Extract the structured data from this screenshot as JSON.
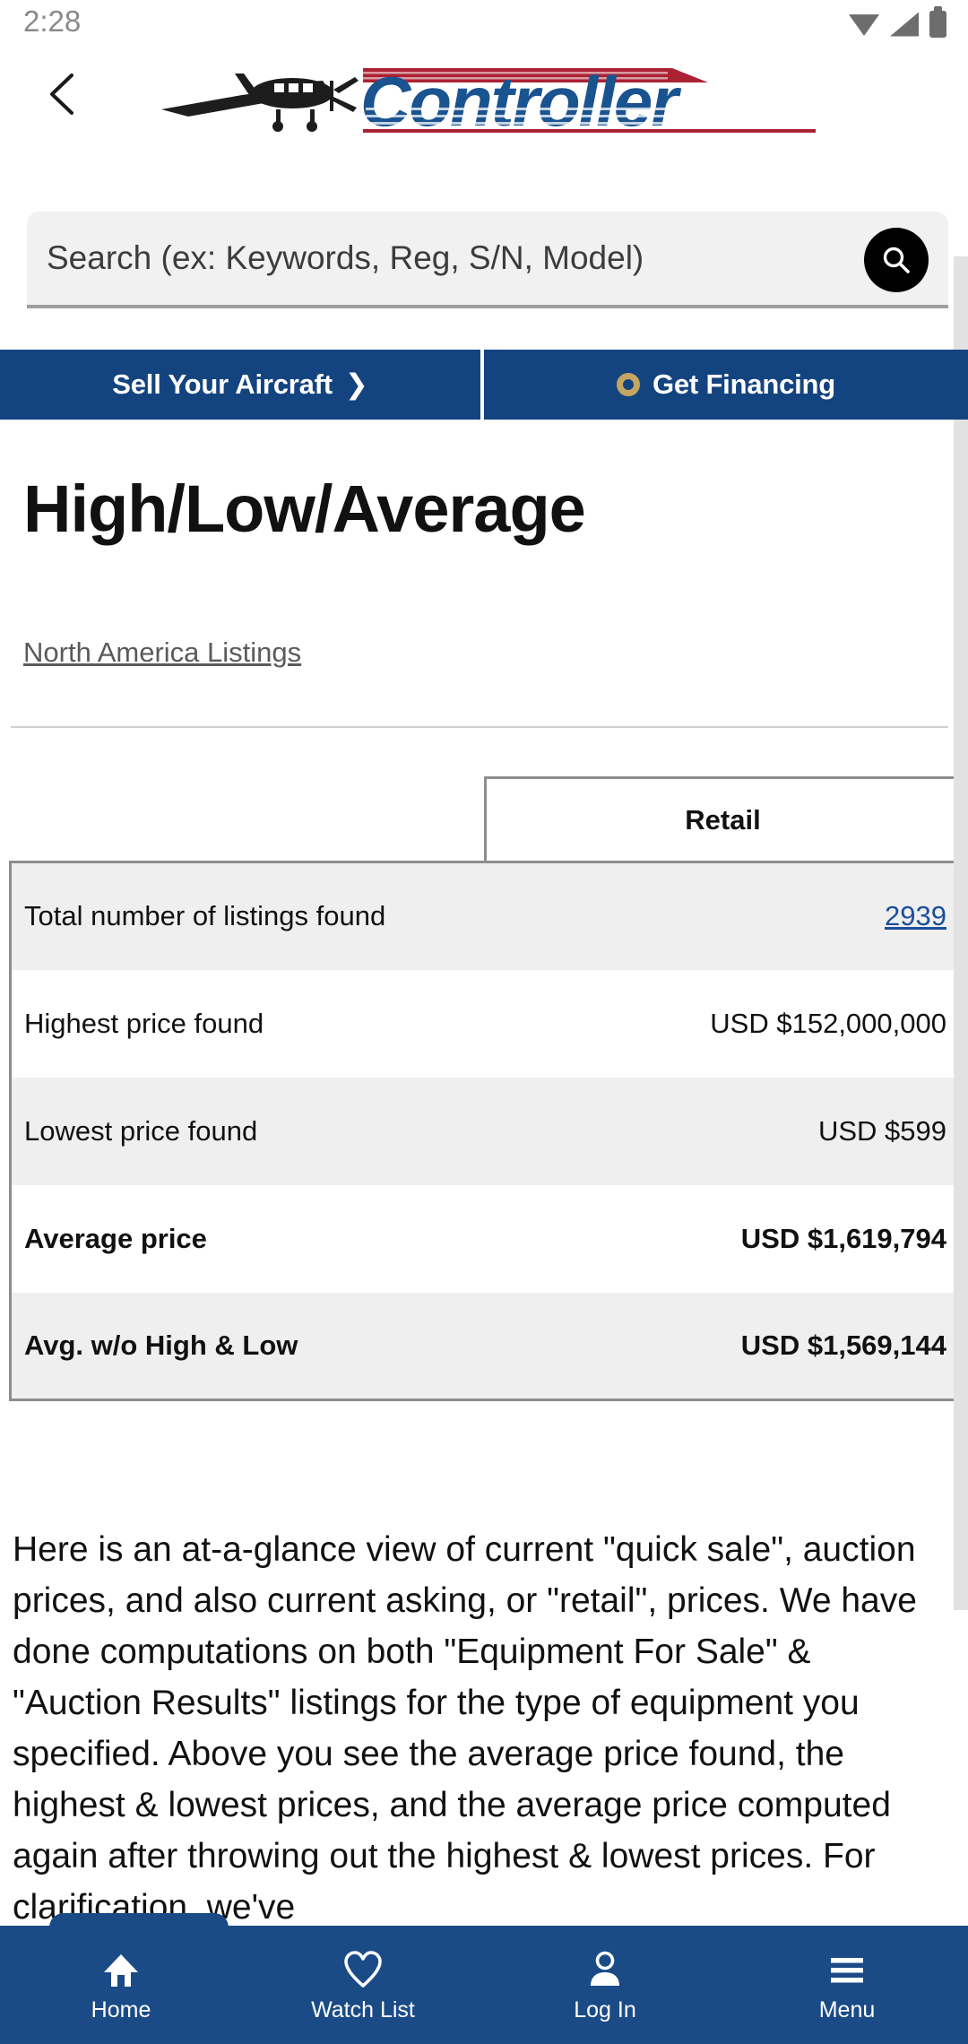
{
  "status_bar": {
    "time": "2:28",
    "icons": [
      "wifi-icon",
      "cell-signal-icon",
      "battery-icon"
    ]
  },
  "header": {
    "back_icon": "chevron-left-icon",
    "logo_text": "Controller",
    "logo_icon": "airplane-icon"
  },
  "search": {
    "placeholder": "Search (ex: Keywords, Reg, S/N, Model)",
    "value": "",
    "button_icon": "search-icon"
  },
  "action_bar": {
    "sell_label": "Sell Your Aircraft",
    "sell_icon": "chevron-right-icon",
    "financing_label": "Get Financing",
    "financing_icon": "coin-icon"
  },
  "page": {
    "title": "High/Low/Average",
    "region_link": "North America Listings"
  },
  "table": {
    "column_headers": [
      "",
      "Retail"
    ],
    "rows": [
      {
        "label": "Total number of listings found",
        "value": "2939",
        "value_is_link": true,
        "bold": false,
        "shaded": true
      },
      {
        "label": "Highest price found",
        "value": "USD $152,000,000",
        "value_is_link": false,
        "bold": false,
        "shaded": false
      },
      {
        "label": "Lowest price found",
        "value": "USD $599",
        "value_is_link": false,
        "bold": false,
        "shaded": true
      },
      {
        "label": "Average price",
        "value": "USD $1,619,794",
        "value_is_link": false,
        "bold": true,
        "shaded": false
      },
      {
        "label": "Avg. w/o High & Low",
        "value": "USD $1,569,144",
        "value_is_link": false,
        "bold": true,
        "shaded": true
      }
    ]
  },
  "blurb": {
    "text": "Here is an at-a-glance view of current \"quick sale\", auction prices, and also current asking, or \"retail\", prices. We have done computations on both \"Equipment For Sale\" & \"Auction Results\" listings for the type of equipment you specified. Above you see the average price found, the highest & lowest prices, and the average price computed again after throwing out the highest & lowest prices. For clarification, we've"
  },
  "bottom_nav": {
    "items": [
      {
        "label": "Home",
        "icon": "home-icon"
      },
      {
        "label": "Watch List",
        "icon": "heart-icon"
      },
      {
        "label": "Log In",
        "icon": "person-icon"
      },
      {
        "label": "Menu",
        "icon": "hamburger-icon"
      }
    ]
  },
  "colors": {
    "brand_blue": "#14447f",
    "nav_blue": "#1b4b86",
    "logo_blue": "#1a5490",
    "logo_red": "#ab2233",
    "link_blue": "#1a4f9c",
    "coin_gold": "#c3a661"
  }
}
